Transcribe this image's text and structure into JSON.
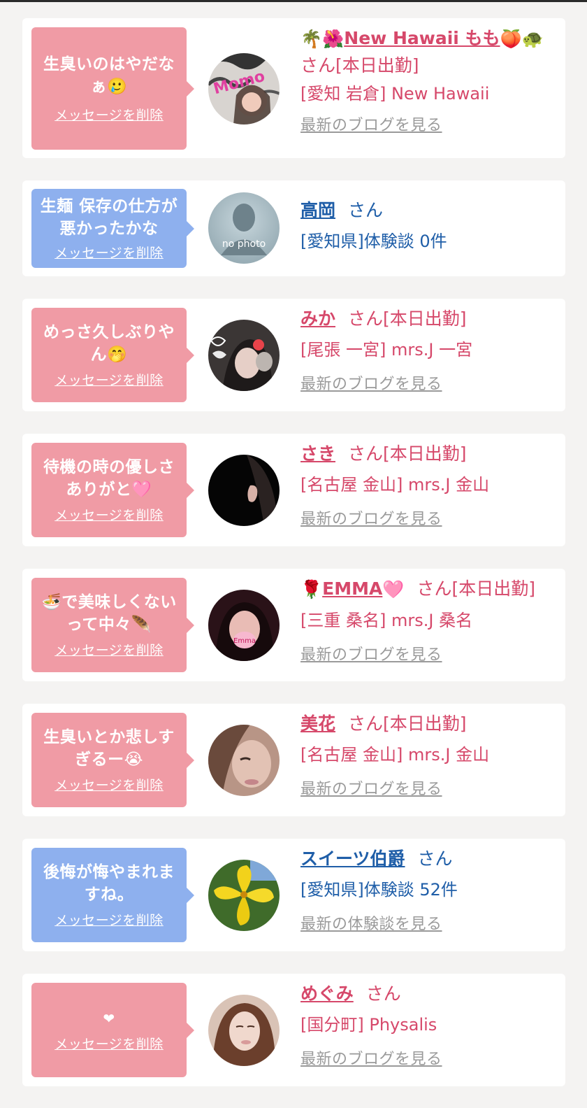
{
  "colors": {
    "pink_name": "#d6486a",
    "blue_name": "#1f5ea8",
    "pink_bubble": "#f09ba5",
    "blue_bubble": "#8eb0ee",
    "link_gray": "#9a9a9a"
  },
  "cards": [
    {
      "message": "生臭いのはやだなぁ🥲",
      "delete_label": "メッセージを削除",
      "name_prefix": "🌴🌺",
      "name": "New Hawaii もも",
      "name_suffix": "🍑🐢",
      "san_label": "さん[本日出勤]",
      "location": "[愛知 岩倉] New Hawaii",
      "blog_link": "最新のブログを見る",
      "avatar_text": "Momo"
    },
    {
      "message": "生麺 保存の仕方が悪かったかな",
      "delete_label": "メッセージを削除",
      "name": "高岡",
      "san_label": "さん",
      "location": "[愛知県]体験談 0件",
      "avatar_text": "no photo"
    },
    {
      "message": "めっさ久しぶりやん🤭",
      "delete_label": "メッセージを削除",
      "name": "みか",
      "san_label": "さん[本日出勤]",
      "location": "[尾張 一宮] mrs.J 一宮",
      "blog_link": "最新のブログを見る"
    },
    {
      "message": "待機の時の優しさありがと🩷",
      "delete_label": "メッセージを削除",
      "name": "さき",
      "san_label": "さん[本日出勤]",
      "location": "[名古屋 金山] mrs.J 金山",
      "blog_link": "最新のブログを見る"
    },
    {
      "message": "🍜で美味しくないって中々🪶",
      "delete_label": "メッセージを削除",
      "name_prefix": "🌹",
      "name": "EMMA",
      "name_suffix": "🩷",
      "san_label": "さん[本日出勤]",
      "location": "[三重 桑名] mrs.J 桑名",
      "blog_link": "最新のブログを見る",
      "avatar_text": "Emma"
    },
    {
      "message": "生臭いとか悲しすぎるー😭",
      "delete_label": "メッセージを削除",
      "name": "美花",
      "san_label": "さん[本日出勤]",
      "location": "[名古屋 金山] mrs.J 金山",
      "blog_link": "最新のブログを見る"
    },
    {
      "message": "後悔が悔やまれますね。",
      "delete_label": "メッセージを削除",
      "name": "スイーツ伯爵",
      "san_label": "さん",
      "location": "[愛知県]体験談 52件",
      "blog_link": "最新の体験談を見る"
    },
    {
      "message": "❤",
      "delete_label": "メッセージを削除",
      "name": "めぐみ",
      "san_label": "さん",
      "location": "[国分町] Physalis",
      "blog_link": "最新のブログを見る"
    }
  ]
}
